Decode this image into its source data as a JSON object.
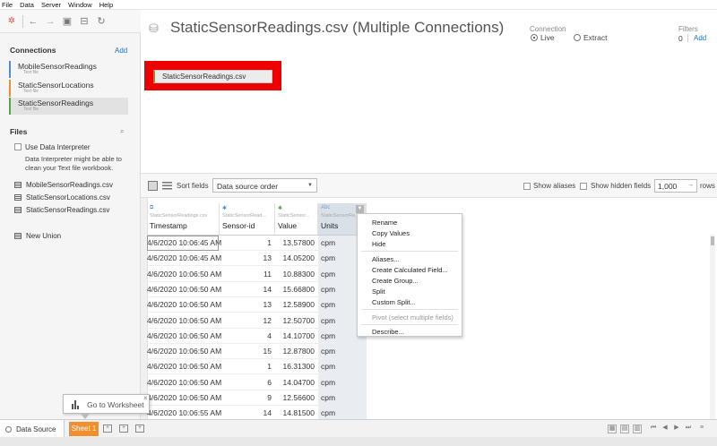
{
  "menu": [
    "File",
    "Data",
    "Server",
    "Window",
    "Help"
  ],
  "left": {
    "connections_title": "Connections",
    "add_label": "Add",
    "connections": [
      {
        "name": "MobileSensorReadings",
        "type": "Text file"
      },
      {
        "name": "StaticSensorLocations",
        "type": "Text file"
      },
      {
        "name": "StaticSensorReadings",
        "type": "Text file"
      }
    ],
    "files_title": "Files",
    "use_interpreter": "Use Data Interpreter",
    "interpreter_desc_1": "Data Interpreter might be able to",
    "interpreter_desc_2": "clean your Text file workbook.",
    "files": [
      "MobileSensorReadings.csv",
      "StaticSensorLocations.csv",
      "StaticSensorReadings.csv"
    ],
    "new_union": "New Union"
  },
  "canvas": {
    "title": "StaticSensorReadings.csv (Multiple Connections)",
    "connection_label": "Connection",
    "live_label": "Live",
    "extract_label": "Extract",
    "connection_mode": "Live",
    "filters_label": "Filters",
    "filters_count": "0",
    "filters_add": "Add",
    "table_pill": "StaticSensorReadings.csv"
  },
  "gridbar": {
    "sort_label": "Sort fields",
    "sort_value": "Data source order",
    "show_aliases": "Show aliases",
    "show_hidden": "Show hidden fields",
    "rows_value": "1,000",
    "rows_label": "rows"
  },
  "grid": {
    "columns": [
      {
        "type_label": "",
        "source": "StaticSensorReadings.csv",
        "name": "Timestamp"
      },
      {
        "type_label": "",
        "source": "StaticSensorRead...",
        "name": "Sensor-id"
      },
      {
        "type_label": "",
        "source": "StaticSensor...",
        "name": "Value"
      },
      {
        "type_label": "Abc",
        "source": "StaticSensorRe...",
        "name": "Units"
      }
    ],
    "rows": [
      [
        "4/6/2020 10:06:45 AM",
        "1",
        "13.57800",
        "cpm"
      ],
      [
        "4/6/2020 10:06:45 AM",
        "13",
        "14.05200",
        "cpm"
      ],
      [
        "4/6/2020 10:06:50 AM",
        "11",
        "10.88300",
        "cpm"
      ],
      [
        "4/6/2020 10:06:50 AM",
        "14",
        "15.66800",
        "cpm"
      ],
      [
        "4/6/2020 10:06:50 AM",
        "13",
        "12.58900",
        "cpm"
      ],
      [
        "4/6/2020 10:06:50 AM",
        "12",
        "12.50700",
        "cpm"
      ],
      [
        "4/6/2020 10:06:50 AM",
        "4",
        "14.10700",
        "cpm"
      ],
      [
        "4/6/2020 10:06:50 AM",
        "15",
        "12.87800",
        "cpm"
      ],
      [
        "4/6/2020 10:06:50 AM",
        "1",
        "16.31300",
        "cpm"
      ],
      [
        "4/6/2020 10:06:50 AM",
        "6",
        "14.04700",
        "cpm"
      ],
      [
        "4/6/2020 10:06:50 AM",
        "9",
        "12.56600",
        "cpm"
      ],
      [
        "4/6/2020 10:06:55 AM",
        "14",
        "14.81500",
        "cpm"
      ]
    ]
  },
  "context_menu": {
    "items": [
      {
        "label": "Rename",
        "disabled": false
      },
      {
        "label": "Copy Values",
        "disabled": false
      },
      {
        "label": "Hide",
        "disabled": false
      },
      {
        "label": "Aliases...",
        "disabled": false
      },
      {
        "label": "Create Calculated Field...",
        "disabled": false
      },
      {
        "label": "Create Group...",
        "disabled": false
      },
      {
        "label": "Split",
        "disabled": false
      },
      {
        "label": "Custom Split...",
        "disabled": false
      },
      {
        "label": "Pivot (select multiple fields)",
        "disabled": true
      },
      {
        "label": "Describe...",
        "disabled": false
      }
    ]
  },
  "tooltip": {
    "text": "Go to Worksheet"
  },
  "tabs": {
    "data_source": "Data Source",
    "sheet": "Sheet 1"
  },
  "colors": {
    "accent_orange": "#f28e2b",
    "highlight_red": "#ee0000",
    "link_blue": "#1f77b4"
  }
}
